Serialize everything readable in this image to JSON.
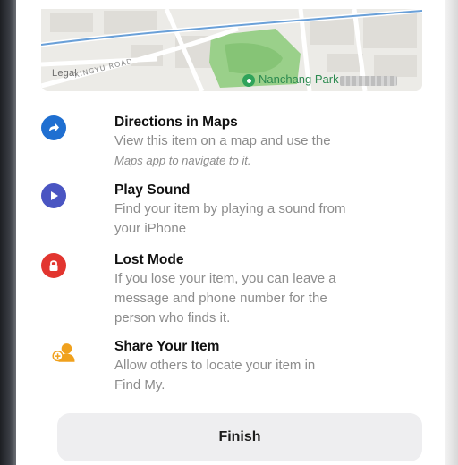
{
  "map": {
    "legal": "Legal",
    "road": "XINGYU ROAD",
    "park": "Nanchang Park"
  },
  "options": [
    {
      "title": "Directions in Maps",
      "desc1": "View this item on a map and use the",
      "desc2": "Maps app to navigate to it.",
      "icon": "directions-arrow-icon",
      "color": "#1f6fd1"
    },
    {
      "title": "Play Sound",
      "desc1": "Find your item by playing a sound from",
      "desc2": "your iPhone",
      "icon": "play-icon",
      "color": "#4a55c2"
    },
    {
      "title": "Lost Mode",
      "desc1": "If you lose your item, you can leave a",
      "desc2": "message and phone number for the",
      "desc3": "person who finds it.",
      "icon": "lock-icon",
      "color": "#e2352f"
    },
    {
      "title": "Share Your Item",
      "desc1": "Allow others to locate your item in",
      "desc2": "Find My.",
      "icon": "share-person-icon",
      "color": "#f0a11d"
    }
  ],
  "finish_label": "Finish"
}
